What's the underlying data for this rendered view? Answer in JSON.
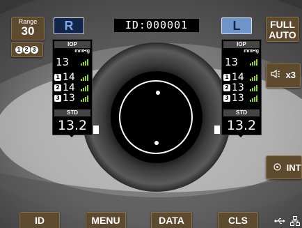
{
  "range": {
    "label": "Range",
    "value": "30"
  },
  "sequence": {
    "items": [
      "1",
      "2",
      "3"
    ]
  },
  "eyes": {
    "right": "R",
    "left": "L"
  },
  "patient_id": "ID:000001",
  "right_buttons": {
    "full_auto_line1": "FULL",
    "full_auto_line2": "AUTO",
    "sound_icon": "speaker-icon",
    "sound_label": "x3",
    "int_icon": "target-icon",
    "int_label": "INT"
  },
  "right_eye": {
    "header": "IOP",
    "unit": "mmHg",
    "main": "13",
    "readings": [
      {
        "n": "1",
        "v": "14"
      },
      {
        "n": "2",
        "v": "14"
      },
      {
        "n": "3",
        "v": "13"
      }
    ],
    "std_label": "STD",
    "std_value": "13.2"
  },
  "left_eye": {
    "header": "IOP",
    "unit": "mmHg",
    "main": "13",
    "readings": [
      {
        "n": "1",
        "v": "14"
      },
      {
        "n": "2",
        "v": "13"
      },
      {
        "n": "3",
        "v": "13"
      }
    ],
    "std_label": "STD",
    "std_value": "13.2"
  },
  "bottom_bar": {
    "id": "ID",
    "menu": "MENU",
    "data": "DATA",
    "cls": "CLS"
  },
  "status_icons": [
    "usb-icon",
    "network-icon"
  ],
  "colors": {
    "button_bg": "#5e4a2f",
    "eye_right_bg": "#13264a",
    "eye_left_bg": "#6e94c8",
    "signal_green": "#8fd037"
  }
}
